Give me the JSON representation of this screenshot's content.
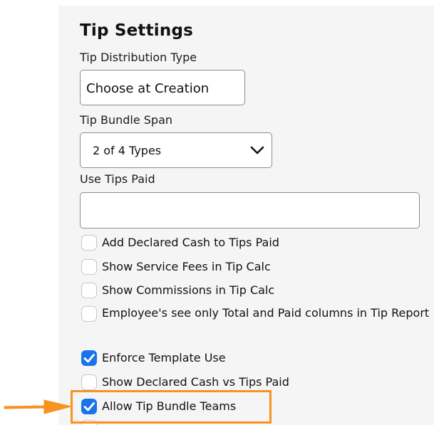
{
  "section": {
    "title": "Tip Settings"
  },
  "distribution": {
    "label": "Tip Distribution Type",
    "value": "Choose at Creation"
  },
  "bundle_span": {
    "label": "Tip Bundle Span",
    "value": "2 of 4 Types"
  },
  "tips_paid": {
    "label": "Use Tips Paid",
    "value": ""
  },
  "options": [
    {
      "label": "Add Declared Cash to Tips Paid",
      "checked": false
    },
    {
      "label": "Show Service Fees in Tip Calc",
      "checked": false
    },
    {
      "label": "Show Commissions in Tip Calc",
      "checked": false
    },
    {
      "label": "Employee's see only Total and Paid columns in Tip Report",
      "checked": false
    },
    {
      "label": "Enforce Template Use",
      "checked": true
    },
    {
      "label": "Show Declared Cash vs Tips Paid",
      "checked": false
    },
    {
      "label": "Allow Tip Bundle Teams",
      "checked": true
    }
  ],
  "colors": {
    "accent": "#1a73e8",
    "highlight": "#f7931e",
    "panel_bg": "#f5f5f5"
  },
  "icons": {
    "select": "chevron-down-icon",
    "check": "checkmark-icon",
    "annotation": "arrow-right-icon"
  }
}
